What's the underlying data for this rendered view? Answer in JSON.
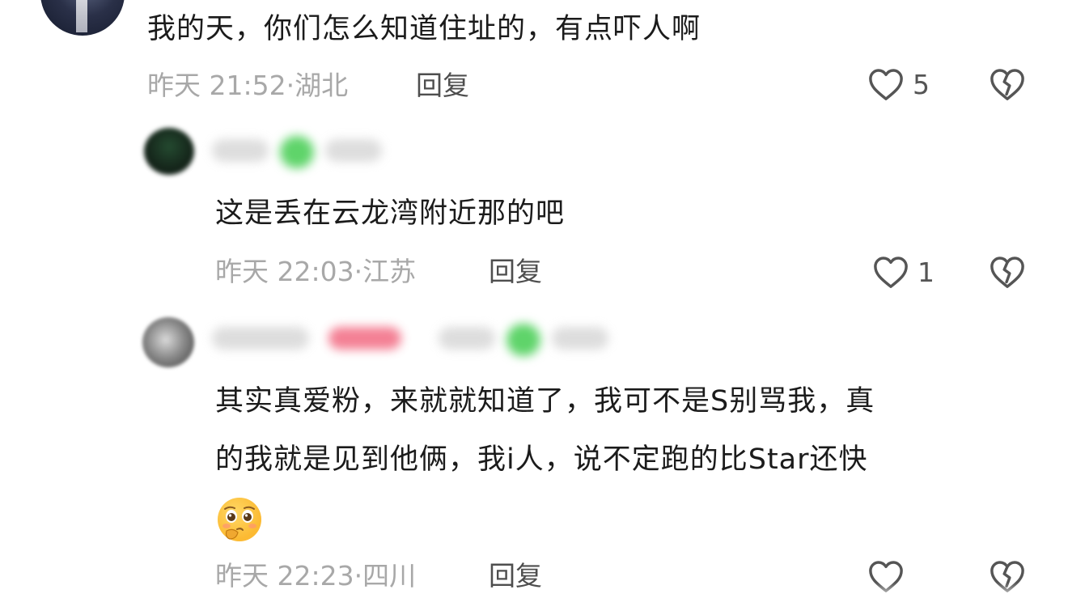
{
  "comment_main": {
    "text": "我的天，你们怎么知道住址的，有点吓人啊",
    "date": "昨天 21:52",
    "location": "湖北",
    "reply_label": "回复",
    "likes": "5"
  },
  "reply_1": {
    "text": "这是丢在云龙湾附近那的吧",
    "date": "昨天 22:03",
    "location": "江苏",
    "reply_label": "回复",
    "likes": "1"
  },
  "reply_2": {
    "text_line1": "其实真爱粉，来就就知道了，我可不是S别骂我，真",
    "text_line2": "的我就是见到他俩，我i人，说不定跑的比Star还快",
    "emoji": "pleading-face-emoji",
    "date": "昨天 22:23",
    "location": "四川",
    "reply_label": "回复"
  },
  "colors": {
    "text": "#1b1b1b",
    "meta": "#a8a8a8",
    "icon": "#555555",
    "blur_green": "#5fd46a",
    "blur_pink": "#f26a82"
  },
  "icons": [
    "heart-outline-icon",
    "broken-heart-icon"
  ]
}
